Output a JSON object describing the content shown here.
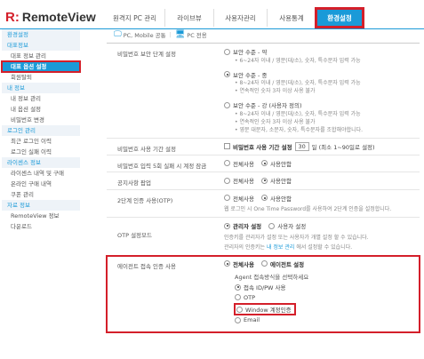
{
  "logo": {
    "mark": "R:",
    "brand": "RemoteView"
  },
  "topnav": [
    {
      "label": "원격지 PC 관리",
      "w": 68
    },
    {
      "label": "라이브뷰",
      "w": 55
    },
    {
      "label": "사용자관리",
      "w": 60
    },
    {
      "label": "사용통계",
      "w": 55
    },
    {
      "label": "환경설정",
      "w": 52,
      "active": true
    }
  ],
  "legend": {
    "mobile": "PC, Mobile 공통",
    "pc": "PC 전용"
  },
  "sidebar": [
    {
      "type": "head",
      "label": "환경설정"
    },
    {
      "type": "head",
      "label": "대표정보"
    },
    {
      "type": "item",
      "label": "대표 정보 관리"
    },
    {
      "type": "item",
      "label": "대표 옵션 설정",
      "active": true
    },
    {
      "type": "item",
      "label": "회원탈퇴"
    },
    {
      "type": "head",
      "label": "내 정보"
    },
    {
      "type": "item",
      "label": "내 정보 관리"
    },
    {
      "type": "item",
      "label": "내 옵션 설정"
    },
    {
      "type": "item",
      "label": "비밀번호 변경"
    },
    {
      "type": "head",
      "label": "로그인 관리"
    },
    {
      "type": "item",
      "label": "최근 로그인 이력"
    },
    {
      "type": "item",
      "label": "로그인 실패 이력"
    },
    {
      "type": "head",
      "label": "라이센스 정보"
    },
    {
      "type": "item",
      "label": "라이센스 내역 및 구매"
    },
    {
      "type": "item",
      "label": "온라인 구매 내역"
    },
    {
      "type": "item",
      "label": "쿠폰 관리"
    },
    {
      "type": "head",
      "label": "자료 정보"
    },
    {
      "type": "item",
      "label": "RemoteView 정보"
    },
    {
      "type": "item",
      "label": "다운로드"
    }
  ],
  "pw_level": {
    "label": "비밀번호 보안 단계 설정",
    "low": {
      "title": "보안 수준 - 약",
      "notes": [
        "• 6~24자 이내 / 영문(대/소), 숫자, 특수문자 입력 가능"
      ]
    },
    "mid": {
      "title": "보안 수준 - 중",
      "notes": [
        "• 8~24자 이내 / 영문(대/소), 숫자, 특수문자 입력 가능",
        "• 연속적인 숫자 3자 이상 사용 불가"
      ]
    },
    "high": {
      "title": "보안 수준 - 강 (사용자 정의)",
      "notes": [
        "• 8~24자 이내 / 영문(대/소), 숫자, 특수문자 입력 가능",
        "• 연속적인 숫자 3자 이상 사용 불가",
        "• 영문 대문자, 소문자, 숫자, 특수문자를 조합해야합니다."
      ]
    }
  },
  "pw_period": {
    "label": "비밀번호 사용 기간 설정",
    "check": "비밀번호 사용 기간 설정",
    "days": "30",
    "suffix": "일 (최소 1~90일로 설정)"
  },
  "pw_fail": {
    "label": "비밀번호 입력 5회 실패 시 계정 잠금",
    "opt1": "전체사용",
    "opt2": "사용안함"
  },
  "notice": {
    "label": "공지사항 팝업",
    "opt1": "전체사용",
    "opt2": "사용안함"
  },
  "otp2": {
    "label": "2단계 인증 사용(OTP)",
    "opt1": "전체사용",
    "opt2": "사용안함",
    "note": "웹 로그인 시 One Time Password를 사용하여 2단계 인증을 설정합니다."
  },
  "otp_mode": {
    "label": "OTP 설정모드",
    "opt1": "관리자 설정",
    "opt2": "사용자 설정",
    "note1": "인증키를 관리자가 설정 또는 사용자가 개별 설정 할 수 있습니다.",
    "note2_pre": "관리자의 인증키는 ",
    "note2_link": "내 정보 관리",
    "note2_post": " 에서 설정할 수 있습니다."
  },
  "agent": {
    "label": "에이전트 접속 인증 사용",
    "opt1": "전체사용",
    "opt2": "에이전트 설정",
    "sub_title": "Agent 접속방식을 선택하세요",
    "methods": [
      "접속 ID/PW 사용",
      "OTP",
      "Window 계정인증",
      "Email"
    ]
  }
}
